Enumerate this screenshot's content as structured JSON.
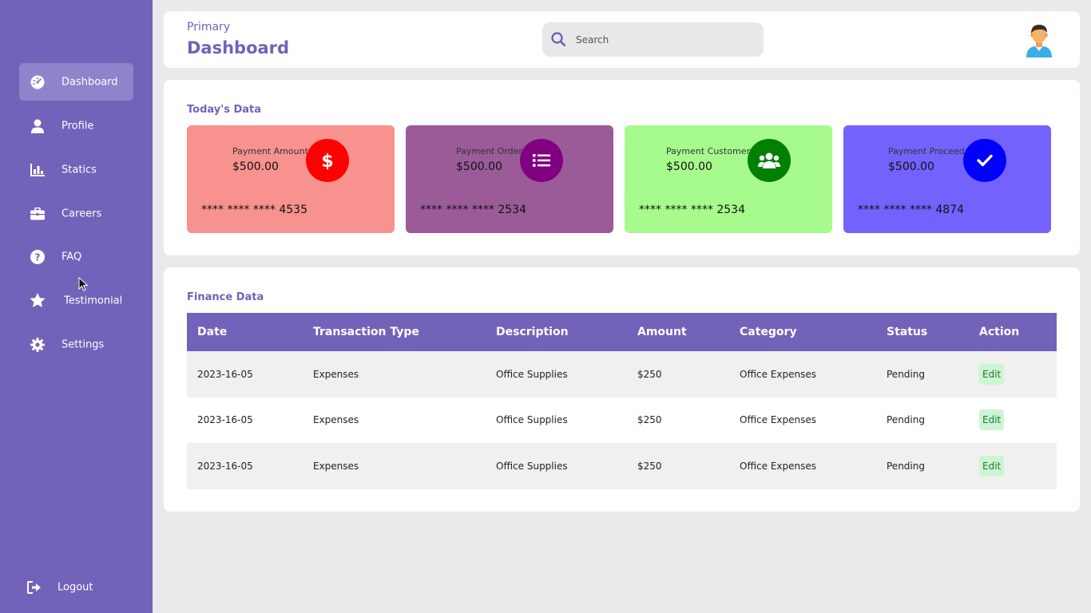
{
  "sidebar": {
    "items": [
      {
        "label": "Dashboard",
        "icon": "dashboard-icon",
        "active": true
      },
      {
        "label": "Profile",
        "icon": "user-icon"
      },
      {
        "label": "Statics",
        "icon": "chart-icon"
      },
      {
        "label": "Careers",
        "icon": "briefcase-icon"
      },
      {
        "label": "FAQ",
        "icon": "question-icon"
      },
      {
        "label": "Testimonial",
        "icon": "star-icon"
      },
      {
        "label": "Settings",
        "icon": "gear-icon"
      }
    ],
    "logout_label": "Logout"
  },
  "header": {
    "subtitle": "Primary",
    "title": "Dashboard",
    "search_placeholder": "Search"
  },
  "today": {
    "title": "Today's Data",
    "cards": [
      {
        "label": "Payment Amount",
        "value": "$500.00",
        "number": "**** **** **** 4535",
        "bg": "#f7928e",
        "icon_bg": "#ff0000",
        "icon": "dollar-icon"
      },
      {
        "label": "Payment Order",
        "value": "$500.00",
        "number": "**** **** **** 2534",
        "bg": "#9b5b99",
        "icon_bg": "#800080",
        "icon": "list-icon"
      },
      {
        "label": "Payment Customer",
        "value": "$500.00",
        "number": "**** **** **** 2534",
        "bg": "#a7fb8d",
        "icon_bg": "#008000",
        "icon": "users-icon"
      },
      {
        "label": "Payment Proceed",
        "value": "$500.00",
        "number": "**** **** **** 4874",
        "bg": "#7362fd",
        "icon_bg": "#0000ff",
        "icon": "check-icon"
      }
    ]
  },
  "finance": {
    "title": "Finance Data",
    "columns": [
      "Date",
      "Transaction Type",
      "Description",
      "Amount",
      "Category",
      "Status",
      "Action"
    ],
    "rows": [
      {
        "date": "2023-16-05",
        "type": "Expenses",
        "description": "Office Supplies",
        "amount": "$250",
        "category": "Office Expenses",
        "status": "Pending",
        "action": "Edit"
      },
      {
        "date": "2023-16-05",
        "type": "Expenses",
        "description": "Office Supplies",
        "amount": "$250",
        "category": "Office Expenses",
        "status": "Pending",
        "action": "Edit"
      },
      {
        "date": "2023-16-05",
        "type": "Expenses",
        "description": "Office Supplies",
        "amount": "$250",
        "category": "Office Expenses",
        "status": "Pending",
        "action": "Edit"
      }
    ]
  },
  "colors": {
    "brand": "#7262b9",
    "sidebar_active": "#8f83cc",
    "edit_bg": "#cdf5d3",
    "edit_text": "#1b7a2e"
  }
}
